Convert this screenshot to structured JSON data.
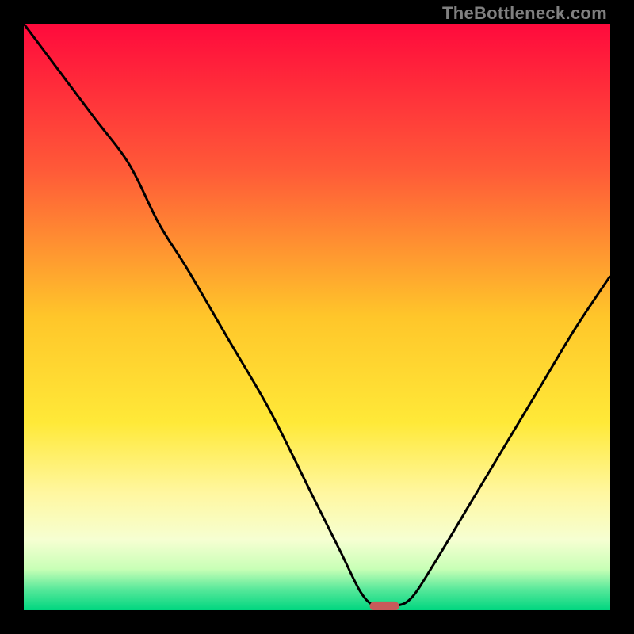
{
  "watermark": "TheBottleneck.com",
  "chart_data": {
    "type": "line",
    "title": "",
    "xlabel": "",
    "ylabel": "",
    "xlim": [
      0,
      100
    ],
    "ylim": [
      0,
      100
    ],
    "gradient_stops": [
      {
        "offset": 0,
        "color": "#ff0a3c"
      },
      {
        "offset": 0.25,
        "color": "#ff5a38"
      },
      {
        "offset": 0.5,
        "color": "#ffc62a"
      },
      {
        "offset": 0.68,
        "color": "#ffe938"
      },
      {
        "offset": 0.8,
        "color": "#fff7a0"
      },
      {
        "offset": 0.88,
        "color": "#f6ffd2"
      },
      {
        "offset": 0.93,
        "color": "#c8ffb6"
      },
      {
        "offset": 0.965,
        "color": "#56e89a"
      },
      {
        "offset": 1.0,
        "color": "#00d680"
      }
    ],
    "series": [
      {
        "name": "bottleneck-curve",
        "x": [
          0,
          6,
          12,
          18,
          23,
          28,
          35,
          42,
          49,
          54,
          57.5,
          60,
          63,
          66,
          70,
          76,
          82,
          88,
          94,
          100
        ],
        "y": [
          100,
          92,
          84,
          76,
          66,
          58,
          46,
          34,
          20,
          10,
          3,
          0.7,
          0.7,
          2,
          8,
          18,
          28,
          38,
          48,
          57
        ]
      }
    ],
    "marker": {
      "x": 61.5,
      "y": 0.7,
      "w": 5,
      "h": 1.6,
      "color": "#c75a5a"
    }
  }
}
